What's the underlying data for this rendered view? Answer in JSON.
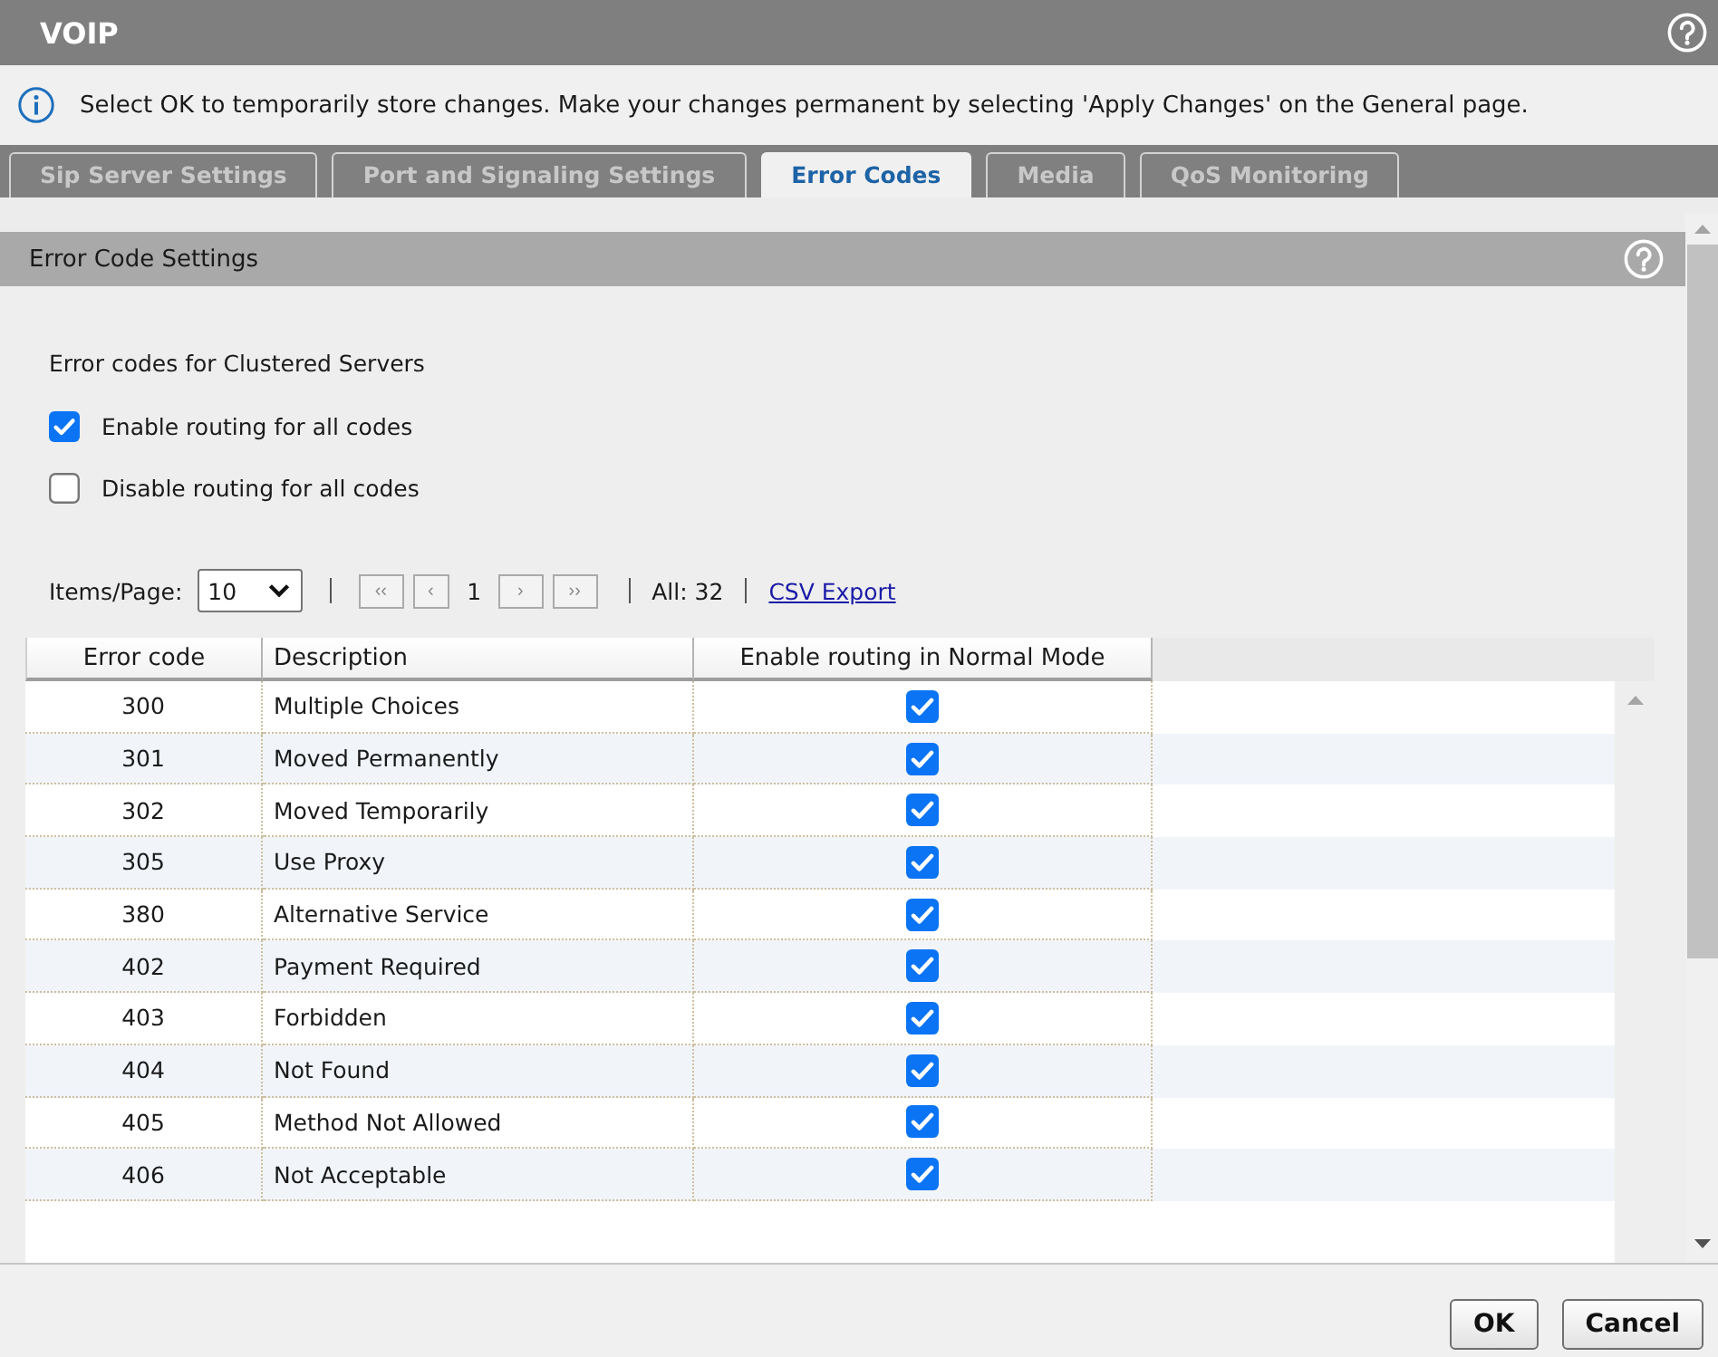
{
  "window": {
    "title": "VOIP"
  },
  "info_bar": {
    "text": "Select OK to temporarily store changes. Make your changes permanent by selecting 'Apply Changes' on the General page."
  },
  "tabs": [
    {
      "label": "Sip Server Settings",
      "selected": false
    },
    {
      "label": "Port and Signaling Settings",
      "selected": false
    },
    {
      "label": "Error Codes",
      "selected": true
    },
    {
      "label": "Media",
      "selected": false
    },
    {
      "label": "QoS Monitoring",
      "selected": false
    }
  ],
  "section": {
    "title": "Error Code Settings"
  },
  "clustered": {
    "label": "Error codes for Clustered Servers",
    "options": [
      {
        "label": "Enable routing for all codes",
        "checked": true
      },
      {
        "label": "Disable routing for all codes",
        "checked": false
      }
    ]
  },
  "pager": {
    "items_label": "Items/Page:",
    "items_per_page": "10",
    "first": "‹‹",
    "previous": "‹",
    "page": "1",
    "next": "›",
    "last": "››",
    "total": "All: 32",
    "export_link": "CSV Export"
  },
  "table": {
    "columns": [
      "Error code",
      "Description",
      "Enable routing in Normal Mode"
    ],
    "rows": [
      {
        "code": "300",
        "description": "Multiple Choices",
        "enabled": true
      },
      {
        "code": "301",
        "description": "Moved Permanently",
        "enabled": true
      },
      {
        "code": "302",
        "description": "Moved Temporarily",
        "enabled": true
      },
      {
        "code": "305",
        "description": "Use Proxy",
        "enabled": true
      },
      {
        "code": "380",
        "description": "Alternative Service",
        "enabled": true
      },
      {
        "code": "402",
        "description": "Payment Required",
        "enabled": true
      },
      {
        "code": "403",
        "description": "Forbidden",
        "enabled": true
      },
      {
        "code": "404",
        "description": "Not Found",
        "enabled": true
      },
      {
        "code": "405",
        "description": "Method Not Allowed",
        "enabled": true
      },
      {
        "code": "406",
        "description": "Not Acceptable",
        "enabled": true
      }
    ]
  },
  "buttons": [
    "OK",
    "Cancel"
  ]
}
